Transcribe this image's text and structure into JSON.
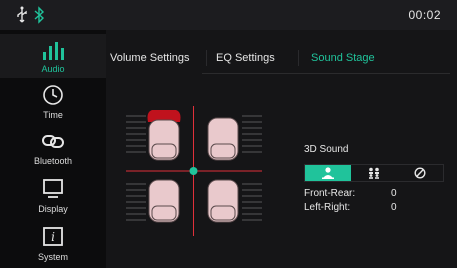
{
  "status_bar": {
    "time": "00:02",
    "usb_icon": "usb-icon",
    "bluetooth_icon": "bluetooth-icon"
  },
  "sidebar": {
    "items": [
      {
        "label": "Audio",
        "icon": "audio-bars-icon",
        "active": true
      },
      {
        "label": "Time",
        "icon": "clock-icon",
        "active": false
      },
      {
        "label": "Bluetooth",
        "icon": "link-icon",
        "active": false
      },
      {
        "label": "Display",
        "icon": "monitor-icon",
        "active": false
      },
      {
        "label": "System",
        "icon": "info-icon",
        "active": false
      }
    ]
  },
  "tabs": [
    {
      "label": "Volume Settings",
      "active": false
    },
    {
      "label": "EQ Settings",
      "active": false
    },
    {
      "label": "Sound Stage",
      "active": true
    }
  ],
  "sound_stage": {
    "section_title": "3D Sound",
    "modes": [
      {
        "icon": "single-person-icon",
        "active": true
      },
      {
        "icon": "group-icon",
        "active": false
      },
      {
        "icon": "disable-icon",
        "active": false
      }
    ],
    "front_rear_label": "Front-Rear:",
    "front_rear_value": "0",
    "left_right_label": "Left-Right:",
    "left_right_value": "0"
  },
  "colors": {
    "accent": "#20c39b",
    "crosshair": "#e0303a",
    "seat": "#e9c9cc",
    "seat_highlight": "#c0121d"
  }
}
